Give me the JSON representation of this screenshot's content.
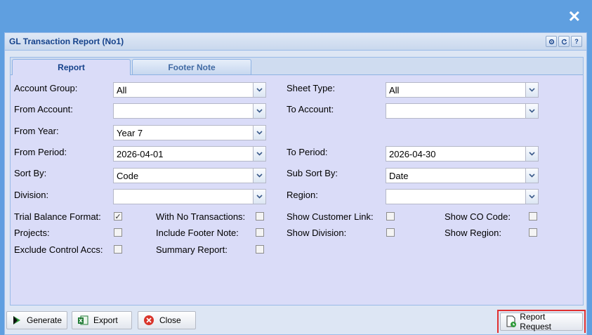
{
  "window": {
    "title": "GL Transaction Report (No1)",
    "tool_icons": [
      "gear-icon",
      "refresh-icon",
      "help-icon"
    ],
    "help_glyph": "?"
  },
  "tabs": [
    {
      "label": "Report",
      "active": true
    },
    {
      "label": "Footer Note",
      "active": false
    }
  ],
  "fields": {
    "account_group": {
      "label": "Account Group:",
      "value": "All"
    },
    "sheet_type": {
      "label": "Sheet Type:",
      "value": "All"
    },
    "from_account": {
      "label": "From Account:",
      "value": ""
    },
    "to_account": {
      "label": "To Account:",
      "value": ""
    },
    "from_year": {
      "label": "From Year:",
      "value": "Year 7"
    },
    "from_period": {
      "label": "From Period:",
      "value": "2026-04-01"
    },
    "to_period": {
      "label": "To Period:",
      "value": "2026-04-30"
    },
    "sort_by": {
      "label": "Sort By:",
      "value": "Code"
    },
    "sub_sort_by": {
      "label": "Sub Sort By:",
      "value": "Date"
    },
    "division": {
      "label": "Division:",
      "value": ""
    },
    "region": {
      "label": "Region:",
      "value": ""
    }
  },
  "checkboxes": {
    "trial_balance_format": {
      "label": "Trial Balance Format:",
      "checked": true
    },
    "with_no_transactions": {
      "label": "With No Transactions:",
      "checked": false
    },
    "show_customer_link": {
      "label": "Show Customer Link:",
      "checked": false
    },
    "show_co_code": {
      "label": "Show CO Code:",
      "checked": false
    },
    "projects": {
      "label": "Projects:",
      "checked": false
    },
    "include_footer_note": {
      "label": "Include Footer Note:",
      "checked": false
    },
    "show_division": {
      "label": "Show Division:",
      "checked": false
    },
    "show_region": {
      "label": "Show Region:",
      "checked": false
    },
    "exclude_control_accs": {
      "label": "Exclude Control Accs:",
      "checked": false
    },
    "summary_report": {
      "label": "Summary Report:",
      "checked": false
    }
  },
  "buttons": {
    "generate": "Generate",
    "export": "Export",
    "close": "Close",
    "report_request": "Report Request"
  },
  "colors": {
    "desktop": "#5f9fe0",
    "title_text": "#15428b",
    "highlight": "#e03030"
  }
}
